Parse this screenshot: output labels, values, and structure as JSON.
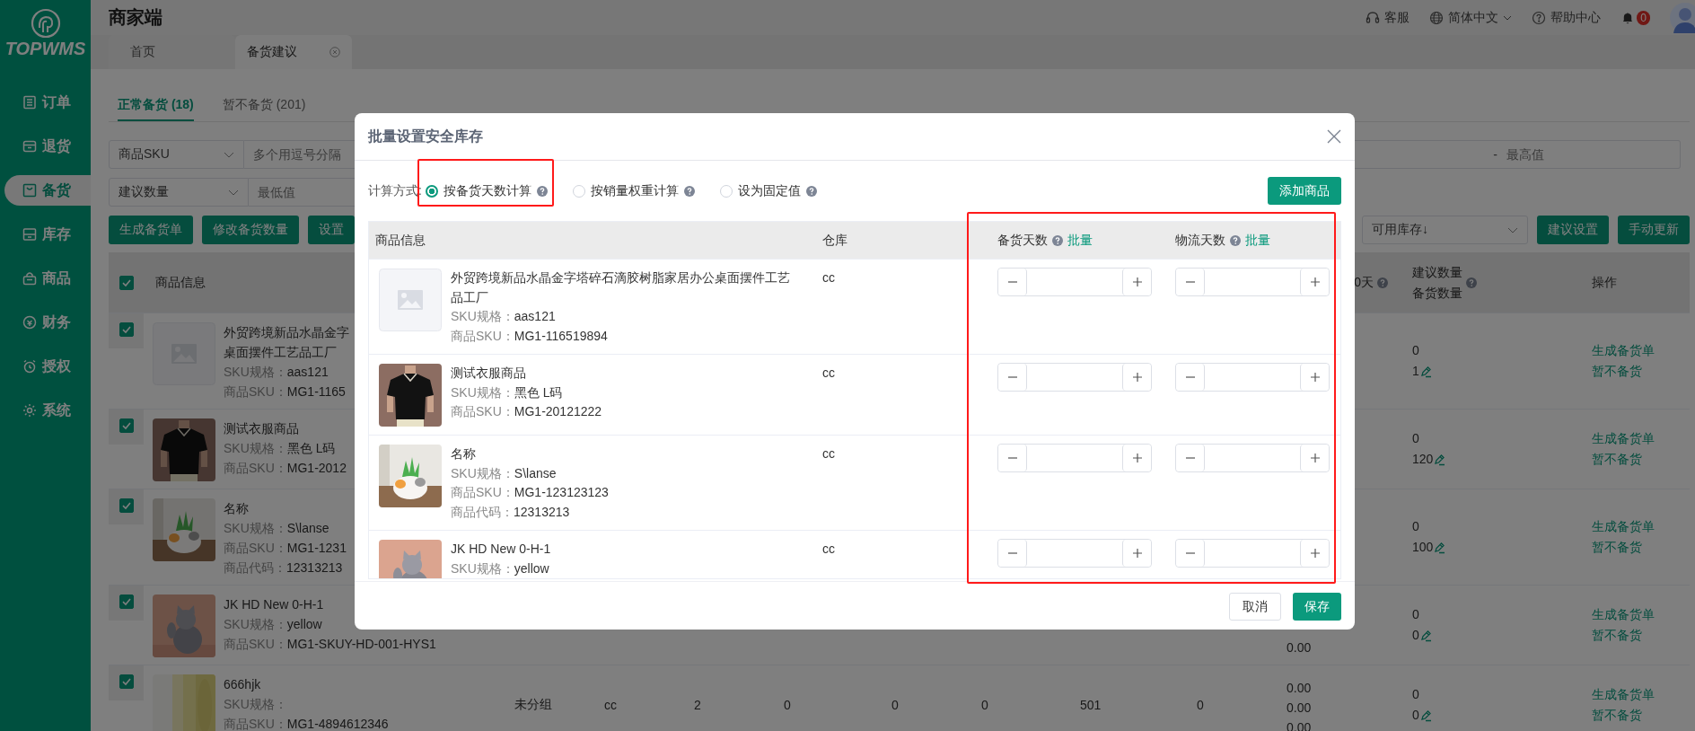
{
  "sidebar": {
    "logo_text": "TOPWMS",
    "items": [
      {
        "label": "订单",
        "selected": false
      },
      {
        "label": "退货",
        "selected": false
      },
      {
        "label": "备货",
        "selected": true
      },
      {
        "label": "库存",
        "selected": false
      },
      {
        "label": "商品",
        "selected": false
      },
      {
        "label": "财务",
        "selected": false
      },
      {
        "label": "授权",
        "selected": false
      },
      {
        "label": "系统",
        "selected": false
      }
    ]
  },
  "header": {
    "title": "商家端",
    "links": [
      {
        "kind": "service",
        "label": "客服"
      },
      {
        "kind": "language",
        "label": "简体中文"
      },
      {
        "kind": "help",
        "label": "帮助中心"
      }
    ],
    "notification_count": "0"
  },
  "tabs": [
    {
      "label": "首页",
      "selected": false,
      "closable": false
    },
    {
      "label": "备货建议",
      "selected": true,
      "closable": true
    }
  ],
  "subtabs": [
    {
      "label": "正常备货 (18)",
      "selected": true
    },
    {
      "label": "暂不备货 (201)",
      "selected": false
    }
  ],
  "filters": {
    "field_select": "商品SKU",
    "field_placeholder": "多个用逗号分隔",
    "range_separator": "-",
    "max_placeholder": "最高值",
    "range_select": "建议数量",
    "min_placeholder": "最低值"
  },
  "toolbar": {
    "buttons": [
      "生成备货单",
      "修改备货数量",
      "设置"
    ],
    "sort_select": "可用库存↓",
    "right_buttons": [
      "建议设置",
      "手动更新"
    ]
  },
  "table": {
    "all_checked": true,
    "columns": {
      "product": "商品信息",
      "stock": "0天",
      "suggested": "建议数量",
      "quantity": "备货数量",
      "actions": "操作"
    },
    "rows": [
      {
        "checked": true,
        "thumb": {
          "kind": "placeholder"
        },
        "name_lines": [
          "外贸跨境新品水晶金字",
          "桌面摆件工艺品工厂"
        ],
        "fields": [
          {
            "label": "SKU规格：",
            "value": "aas121"
          },
          {
            "label": "商品SKU：",
            "value": "MG1-1165"
          }
        ],
        "cells": [],
        "stock": [],
        "suggested": "0",
        "quantity": "1",
        "actions": [
          "生成备货单",
          "暂不备货"
        ]
      },
      {
        "checked": true,
        "thumb": {
          "kind": "picture"
        },
        "name_lines": [
          "测试衣服商品"
        ],
        "fields": [
          {
            "label": "SKU规格：",
            "value": "黑色 L码"
          },
          {
            "label": "商品SKU：",
            "value": "MG1-2012"
          }
        ],
        "cells": [],
        "stock": [],
        "suggested": "0",
        "quantity": "120",
        "actions": [
          "生成备货单",
          "暂不备货"
        ]
      },
      {
        "checked": true,
        "thumb": {
          "kind": "picture"
        },
        "name_lines": [
          "名称"
        ],
        "fields": [
          {
            "label": "SKU规格：",
            "value": "S\\lanse"
          },
          {
            "label": "商品SKU：",
            "value": "MG1-1231"
          },
          {
            "label": "商品代码：",
            "value": "12313213"
          }
        ],
        "cells": [],
        "stock": [],
        "suggested": "0",
        "quantity": "100",
        "actions": [
          "生成备货单",
          "暂不备货"
        ]
      },
      {
        "checked": true,
        "thumb": {
          "kind": "picture"
        },
        "name_lines": [
          "JK HD New 0-H-1"
        ],
        "fields": [
          {
            "label": "SKU规格：",
            "value": "yellow"
          },
          {
            "label": "商品SKU：",
            "value": "MG1-SKUY-HD-001-HYS1"
          }
        ],
        "cells": [],
        "stock": [
          "0.00"
        ],
        "suggested": "0",
        "quantity": "0",
        "actions": [
          "生成备货单",
          "暂不备货"
        ]
      },
      {
        "checked": true,
        "thumb": {
          "kind": "picture"
        },
        "name_lines": [
          "666hjk"
        ],
        "fields": [
          {
            "label": "SKU规格："
          },
          {
            "label": "商品SKU：",
            "value": "MG1-4894612346"
          }
        ],
        "cells": [
          "未分组",
          "cc",
          "2",
          "0",
          "0",
          "0",
          "501",
          "0"
        ],
        "stock": [
          "0.00",
          "0.00",
          "0.00"
        ],
        "suggested": "0",
        "quantity": "0",
        "actions": [
          "生成备货单",
          "暂不备货"
        ]
      }
    ]
  },
  "modal": {
    "title": "批量设置安全库存",
    "method_label": "计算方式:",
    "methods": [
      {
        "label": "按备货天数计算",
        "selected": true,
        "highlighted": true
      },
      {
        "label": "按销量权重计算",
        "selected": false,
        "highlighted": false
      },
      {
        "label": "设为固定值",
        "selected": false,
        "highlighted": false
      }
    ],
    "add_button": "添加商品",
    "inputs_highlighted": true,
    "columns": {
      "product": "商品信息",
      "warehouse": "仓库",
      "stock_days": "备货天数",
      "stock_days_link": "批量",
      "logistics_days": "物流天数",
      "logistics_days_link": "批量"
    },
    "rows": [
      {
        "thumb": {
          "kind": "placeholder"
        },
        "name": "外贸跨境新品水晶金字塔碎石滴胶树脂家居办公桌面摆件工艺品工厂",
        "fields": [
          {
            "label": "SKU规格：",
            "value": "aas121"
          },
          {
            "label": "商品SKU：",
            "value": "MG1-116519894"
          }
        ],
        "warehouse": "cc"
      },
      {
        "thumb": {
          "kind": "picture"
        },
        "name": "测试衣服商品",
        "fields": [
          {
            "label": "SKU规格：",
            "value": "黑色 L码"
          },
          {
            "label": "商品SKU：",
            "value": "MG1-20121222"
          }
        ],
        "warehouse": "cc"
      },
      {
        "thumb": {
          "kind": "picture"
        },
        "name": "名称",
        "fields": [
          {
            "label": "SKU规格：",
            "value": "S\\lanse"
          },
          {
            "label": "商品SKU：",
            "value": "MG1-123123123"
          },
          {
            "label": "商品代码：",
            "value": "12313213"
          }
        ],
        "warehouse": "cc"
      },
      {
        "thumb": {
          "kind": "picture"
        },
        "name": "JK HD New 0-H-1",
        "fields": [
          {
            "label": "SKU规格：",
            "value": "yellow"
          }
        ],
        "warehouse": "cc"
      }
    ],
    "cancel": "取消",
    "save": "保存"
  }
}
